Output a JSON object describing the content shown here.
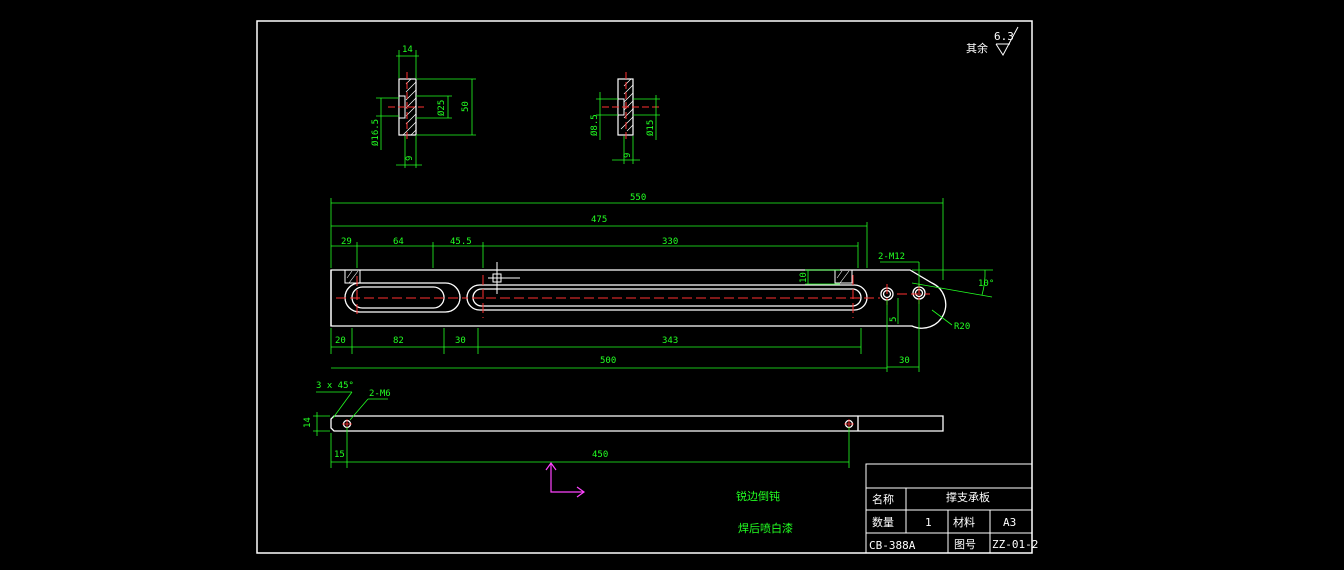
{
  "colors": {
    "background": "#000000",
    "outline": "#ffffff",
    "dimension": "#22ff22",
    "centerline": "#ff3030",
    "ucs": "#ff44ff"
  },
  "roughness": {
    "value": "6.3",
    "prefix": "其余"
  },
  "section_a": {
    "d_top": "14",
    "d_inner": "Ø25",
    "d_outer": "50",
    "d_bore": "Ø16.5",
    "d_bottom": "9"
  },
  "section_b": {
    "d_bore": "Ø8.5",
    "d_outer": "Ø15",
    "d_bottom": "9"
  },
  "front_view": {
    "d_550": "550",
    "d_475": "475",
    "d_29": "29",
    "d_64": "64",
    "d_45_5": "45.5",
    "d_330": "330",
    "d_10": "10",
    "d_5": "5",
    "thread_label": "2-M12",
    "angle": "10°",
    "d_20": "20",
    "d_82": "82",
    "d_30a": "30",
    "d_343": "343",
    "d_500": "500",
    "d_30b": "30",
    "radius": "R20"
  },
  "plan_view": {
    "chamfer": "3 x 45°",
    "thread_label": "2-M6",
    "d_14": "14",
    "d_15": "15",
    "d_450": "450"
  },
  "notes": {
    "line1": "锐边倒钝",
    "line2": "焊后喷白漆"
  },
  "title_block": {
    "name_label": "名称",
    "name_value": "撑支承板",
    "qty_label": "数量",
    "qty_value": "1",
    "material_label": "材料",
    "material_value": "A3",
    "code": "CB-388A",
    "drawing_no_label": "图号",
    "drawing_no": "ZZ-01-2"
  }
}
